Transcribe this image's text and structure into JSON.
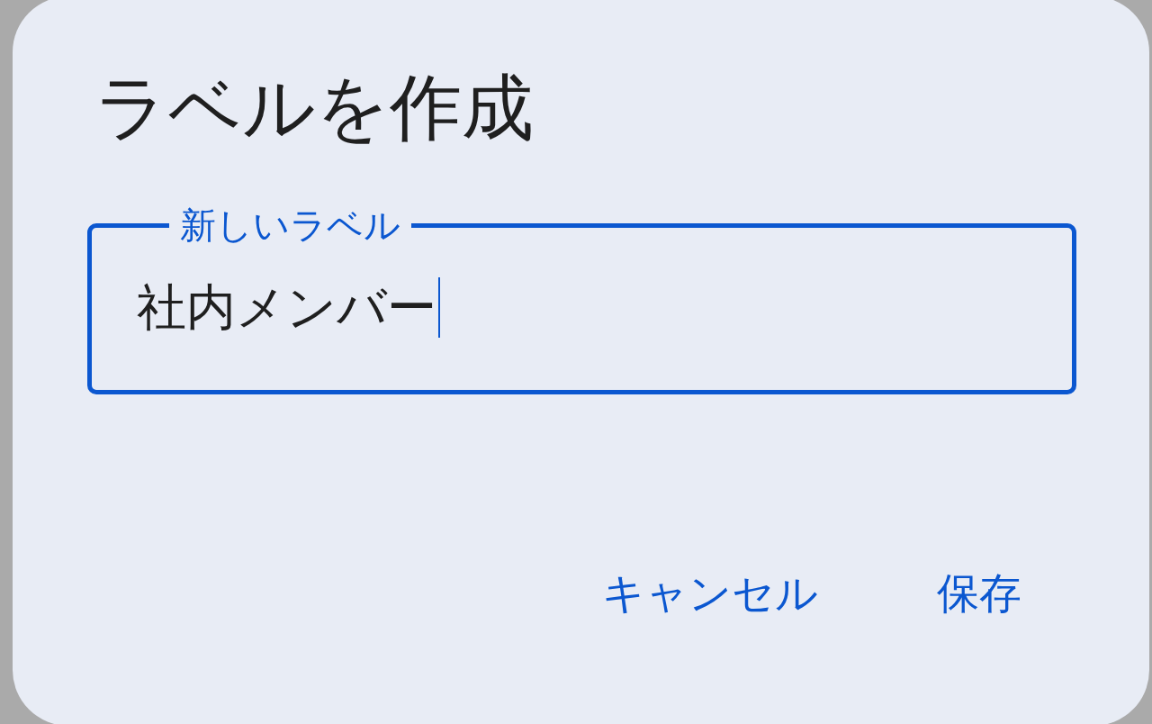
{
  "dialog": {
    "title": "ラベルを作成",
    "field": {
      "label": "新しいラベル",
      "value": "社内メンバー",
      "focused": true
    },
    "buttons": [
      "キャンセル",
      "保存"
    ]
  }
}
